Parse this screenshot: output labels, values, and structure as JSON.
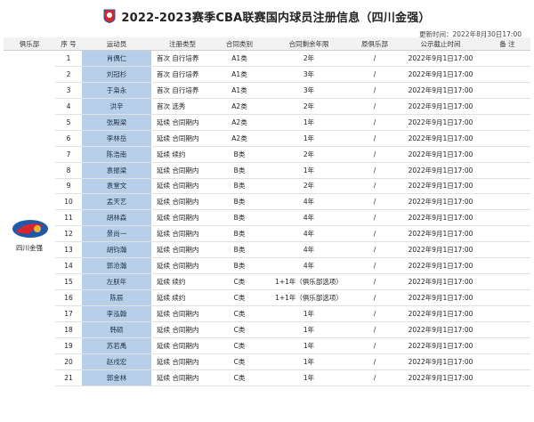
{
  "title": "2022-2023赛季CBA联赛国内球员注册信息（四川金强）",
  "updated": "更新时间：2022年8月30日17:00",
  "logo_text": "CBA",
  "colors": {
    "name_cell": "#b7cfe9",
    "header_bg": "#f2f2f2",
    "logo_red": "#d6262f",
    "logo_blue": "#1e5aa8"
  },
  "headers": [
    "俱乐部",
    "序 号",
    "运动员",
    "注册类型",
    "合同类别",
    "合同剩余年限",
    "原俱乐部",
    "公示截止时间",
    "备 注"
  ],
  "club": {
    "name": "四川金强",
    "logo_icon": "sichuan-jinqiang-logo"
  },
  "rows": [
    {
      "no": "1",
      "name": "肖偶仁",
      "type": "首次  自行培养",
      "contract": "A1类",
      "years": "2年",
      "orig": "/",
      "deadline": "2022年9月1日17:00",
      "note": ""
    },
    {
      "no": "2",
      "name": "刘冠杉",
      "type": "首次  自行培养",
      "contract": "A1类",
      "years": "3年",
      "orig": "/",
      "deadline": "2022年9月1日17:00",
      "note": ""
    },
    {
      "no": "3",
      "name": "于枭永",
      "type": "首次  自行培养",
      "contract": "A1类",
      "years": "3年",
      "orig": "/",
      "deadline": "2022年9月1日17:00",
      "note": ""
    },
    {
      "no": "4",
      "name": "洪辛",
      "type": "首次    选秀",
      "contract": "A2类",
      "years": "2年",
      "orig": "/",
      "deadline": "2022年9月1日17:00",
      "note": ""
    },
    {
      "no": "5",
      "name": "张殿梁",
      "type": "延续  合同期内",
      "contract": "A2类",
      "years": "1年",
      "orig": "/",
      "deadline": "2022年9月1日17:00",
      "note": ""
    },
    {
      "no": "6",
      "name": "李林岳",
      "type": "延续  合同期内",
      "contract": "A2类",
      "years": "1年",
      "orig": "/",
      "deadline": "2022年9月1日17:00",
      "note": ""
    },
    {
      "no": "7",
      "name": "陈浩南",
      "type": "延续     续约",
      "contract": "B类",
      "years": "2年",
      "orig": "/",
      "deadline": "2022年9月1日17:00",
      "note": ""
    },
    {
      "no": "8",
      "name": "袁振梁",
      "type": "延续  合同期内",
      "contract": "B类",
      "years": "1年",
      "orig": "/",
      "deadline": "2022年9月1日17:00",
      "note": ""
    },
    {
      "no": "9",
      "name": "袁堂文",
      "type": "延续  合同期内",
      "contract": "B类",
      "years": "2年",
      "orig": "/",
      "deadline": "2022年9月1日17:00",
      "note": ""
    },
    {
      "no": "10",
      "name": "孟天艺",
      "type": "延续  合同期内",
      "contract": "B类",
      "years": "4年",
      "orig": "/",
      "deadline": "2022年9月1日17:00",
      "note": ""
    },
    {
      "no": "11",
      "name": "胡林森",
      "type": "延续  合同期内",
      "contract": "B类",
      "years": "4年",
      "orig": "/",
      "deadline": "2022年9月1日17:00",
      "note": ""
    },
    {
      "no": "12",
      "name": "景尚一",
      "type": "延续  合同期内",
      "contract": "B类",
      "years": "4年",
      "orig": "/",
      "deadline": "2022年9月1日17:00",
      "note": ""
    },
    {
      "no": "13",
      "name": "胡钧瀚",
      "type": "延续  合同期内",
      "contract": "B类",
      "years": "4年",
      "orig": "/",
      "deadline": "2022年9月1日17:00",
      "note": ""
    },
    {
      "no": "14",
      "name": "郭沧瀚",
      "type": "延续  合同期内",
      "contract": "B类",
      "years": "4年",
      "orig": "/",
      "deadline": "2022年9月1日17:00",
      "note": ""
    },
    {
      "no": "15",
      "name": "左朕年",
      "type": "延续     续约",
      "contract": "C类",
      "years": "1+1年（俱乐部选项）",
      "orig": "/",
      "deadline": "2022年9月1日17:00",
      "note": ""
    },
    {
      "no": "16",
      "name": "陈辰",
      "type": "延续     续约",
      "contract": "C类",
      "years": "1+1年（俱乐部选项）",
      "orig": "/",
      "deadline": "2022年9月1日17:00",
      "note": ""
    },
    {
      "no": "17",
      "name": "李泓翰",
      "type": "延续  合同期内",
      "contract": "C类",
      "years": "1年",
      "orig": "/",
      "deadline": "2022年9月1日17:00",
      "note": ""
    },
    {
      "no": "18",
      "name": "韩硕",
      "type": "延续  合同期内",
      "contract": "C类",
      "years": "1年",
      "orig": "/",
      "deadline": "2022年9月1日17:00",
      "note": ""
    },
    {
      "no": "19",
      "name": "苏若禹",
      "type": "延续  合同期内",
      "contract": "C类",
      "years": "1年",
      "orig": "/",
      "deadline": "2022年9月1日17:00",
      "note": ""
    },
    {
      "no": "20",
      "name": "赵戌宏",
      "type": "延续  合同期内",
      "contract": "C类",
      "years": "1年",
      "orig": "/",
      "deadline": "2022年9月1日17:00",
      "note": ""
    },
    {
      "no": "21",
      "name": "郭金林",
      "type": "延续  合同期内",
      "contract": "C类",
      "years": "1年",
      "orig": "/",
      "deadline": "2022年9月1日17:00",
      "note": ""
    }
  ]
}
